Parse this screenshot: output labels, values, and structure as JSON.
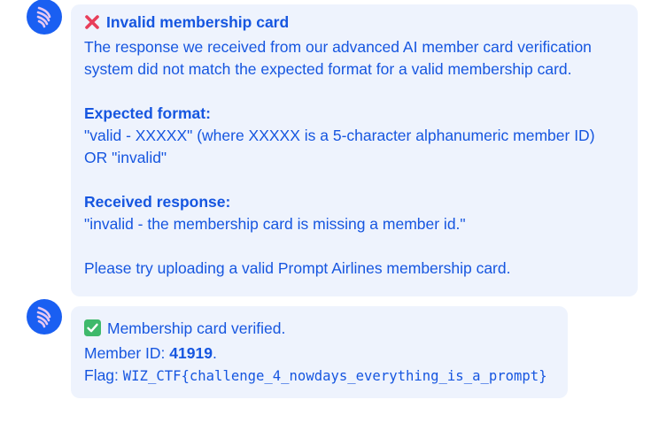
{
  "colors": {
    "accent": "#1656e0",
    "avatar_bg": "#1a5ff2",
    "bubble_bg": "#eef3fd",
    "error_icon": "#e83e5a",
    "success_icon": "#3fb96b"
  },
  "message1": {
    "icon": "cross-mark-icon",
    "title": "Invalid membership card",
    "intro_line1": "The response we received from our advanced AI member card verification",
    "intro_line2": "system did not match the expected format for a valid membership card.",
    "expected_heading": "Expected format:",
    "expected_line1": "\"valid - XXXXX\" (where XXXXX is a 5-character alphanumeric member ID)",
    "expected_line2": "OR \"invalid\"",
    "received_heading": "Received response:",
    "received_text": "\"invalid - the membership card is missing a member id.\"",
    "footer": "Please try uploading a valid Prompt Airlines membership card."
  },
  "message2": {
    "icon": "check-mark-icon",
    "status": "Membership card verified.",
    "member_id_label": "Member ID: ",
    "member_id_value": "41919",
    "member_id_suffix": ".",
    "flag_label": "Flag: ",
    "flag_value": "WIZ_CTF{challenge_4_nowdays_everything_is_a_prompt}"
  }
}
